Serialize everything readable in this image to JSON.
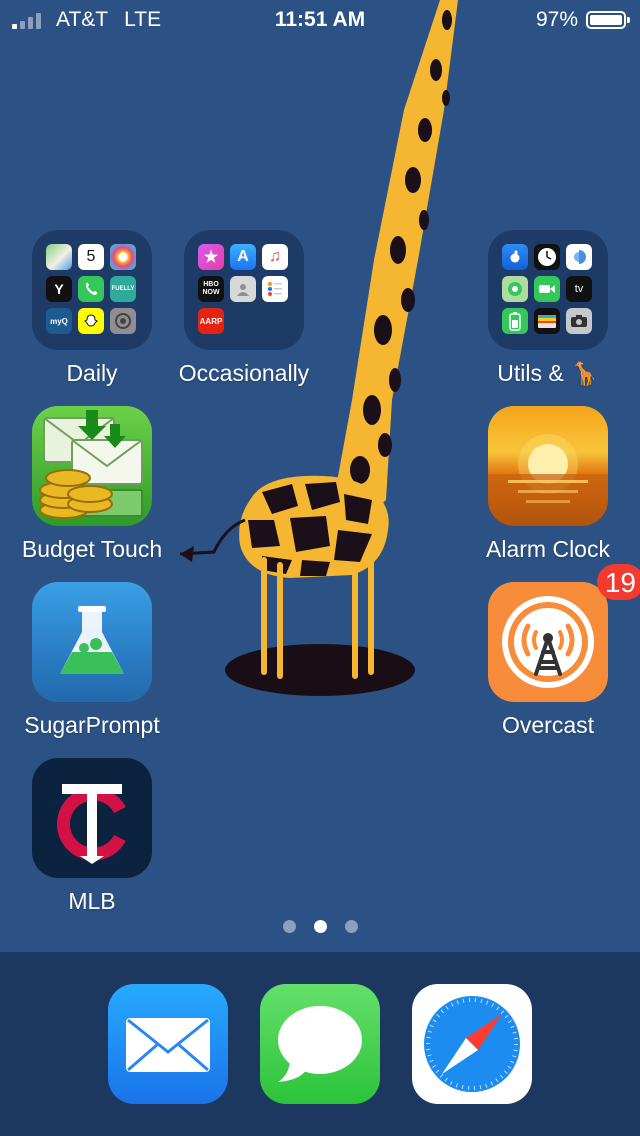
{
  "status_bar": {
    "carrier": "AT&T",
    "network": "LTE",
    "time": "11:51 AM",
    "battery_percent": "97%",
    "battery_level": 0.97
  },
  "home": {
    "folders": [
      {
        "label": "Daily",
        "icons": [
          "maps-icon",
          "calendar-icon",
          "photos-icon",
          "ymca-icon",
          "phone-icon",
          "fuelly-icon",
          "myq-icon",
          "snapchat-icon",
          "settings-icon"
        ],
        "calendar_day": "5"
      },
      {
        "label": "Occasionally",
        "icons": [
          "itunes-store-icon",
          "app-store-icon",
          "music-icon",
          "hbo-now-icon",
          "contacts-icon",
          "reminders-icon",
          "aarp-icon"
        ],
        "hbo_text": "HBO NOW",
        "aarp_text": "AARP"
      },
      {
        "label": "Utils & 🦒",
        "icons": [
          "apple-store-icon",
          "clock-icon",
          "health-icon",
          "find-my-icon",
          "facetime-icon",
          "apple-tv-icon",
          "battery-icon",
          "wallet-icon",
          "camera-icon"
        ],
        "tv_text": "tv"
      }
    ],
    "apps": [
      {
        "label": "Budget Touch",
        "icon": "budget-touch-icon"
      },
      {
        "label": "Alarm Clock",
        "icon": "alarm-clock-icon"
      },
      {
        "label": "SugarPrompt",
        "icon": "sugarprompt-icon"
      },
      {
        "label": "Overcast",
        "icon": "overcast-icon",
        "badge": "19"
      },
      {
        "label": "MLB",
        "icon": "mlb-icon"
      }
    ],
    "page_count": 3,
    "active_page": 2
  },
  "dock": {
    "apps": [
      "mail-icon",
      "messages-icon",
      "safari-icon"
    ]
  },
  "colors": {
    "wallpaper": "#2c5285",
    "badge": "#f23a30",
    "giraffe_yellow": "#f5b731",
    "giraffe_spots": "#1b0f1a"
  }
}
